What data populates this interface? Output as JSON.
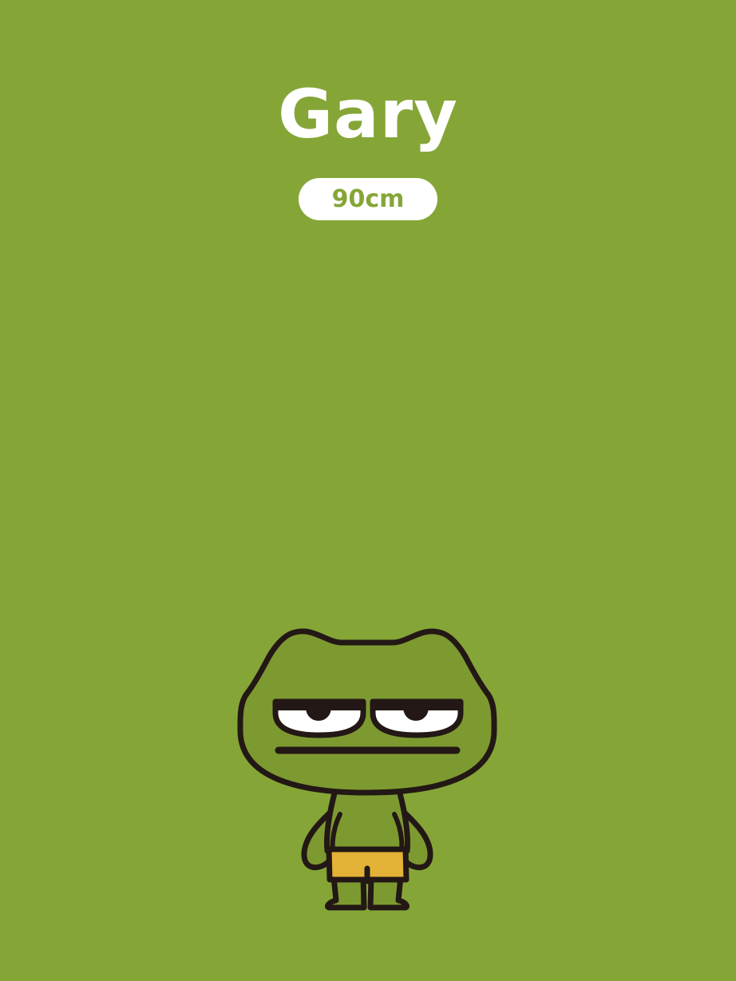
{
  "character": {
    "name": "Gary",
    "height": "90cm"
  },
  "colors": {
    "background": "#85a637",
    "title_text": "#ffffff",
    "badge_background": "#ffffff",
    "badge_text": "#85a637",
    "frog_skin": "#7d9a30",
    "outline": "#231815",
    "shorts": "#e3b236",
    "eye_white": "#ffffff"
  },
  "illustration": {
    "subject": "frog-character-icon"
  }
}
